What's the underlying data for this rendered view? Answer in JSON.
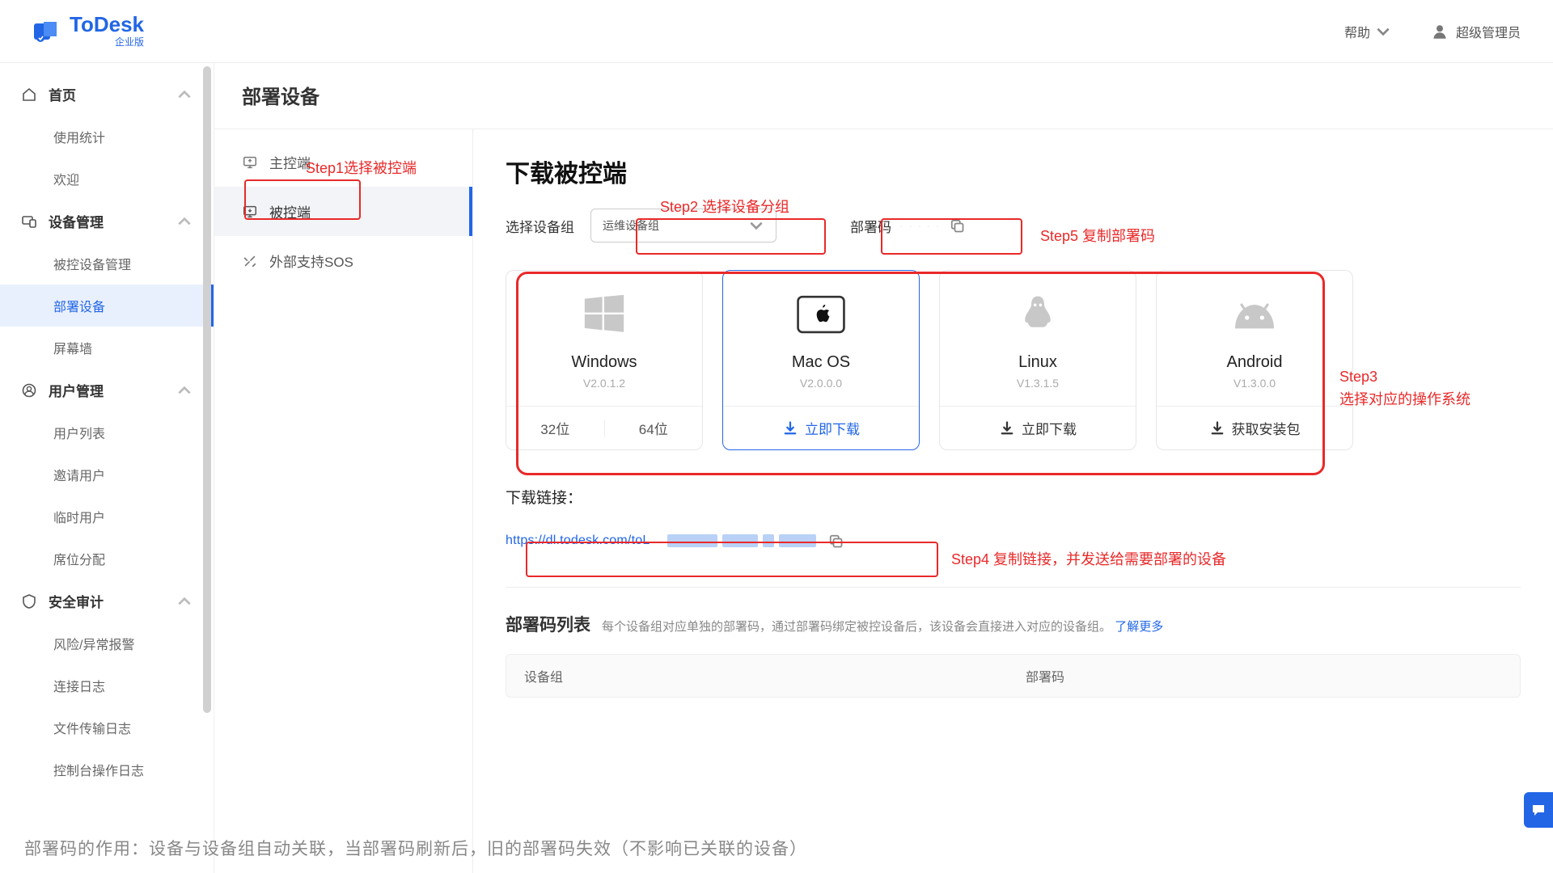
{
  "brand": {
    "name": "ToDesk",
    "edition": "企业版"
  },
  "header": {
    "help": "帮助",
    "user": "超级管理员"
  },
  "sidebar": {
    "groups": [
      {
        "label": "首页",
        "items": [
          "使用统计",
          "欢迎"
        ]
      },
      {
        "label": "设备管理",
        "items": [
          "被控设备管理",
          "部署设备",
          "屏幕墙"
        ],
        "activeIndex": 1
      },
      {
        "label": "用户管理",
        "items": [
          "用户列表",
          "邀请用户",
          "临时用户",
          "席位分配"
        ]
      },
      {
        "label": "安全审计",
        "items": [
          "风险/异常报警",
          "连接日志",
          "文件传输日志",
          "控制台操作日志"
        ]
      }
    ]
  },
  "page": {
    "title": "部署设备"
  },
  "tabs": {
    "items": [
      "主控端",
      "被控端",
      "外部支持SOS"
    ],
    "activeIndex": 1
  },
  "download": {
    "section_title": "下载被控端",
    "group_label": "选择设备组",
    "group_value": "运维设备组",
    "code_label": "部署码",
    "cards": [
      {
        "name": "Windows",
        "ver": "V2.0.1.2",
        "action_a": "32位",
        "action_b": "64位",
        "kind": "split"
      },
      {
        "name": "Mac OS",
        "ver": "V2.0.0.0",
        "action": "立即下载",
        "kind": "primary"
      },
      {
        "name": "Linux",
        "ver": "V1.3.1.5",
        "action": "立即下载",
        "kind": "plain"
      },
      {
        "name": "Android",
        "ver": "V1.3.0.0",
        "action": "获取安装包",
        "kind": "plain"
      }
    ],
    "link_label": "下载链接：",
    "link_url": "https://dl.todesk.com/toL"
  },
  "list": {
    "title": "部署码列表",
    "subtitle": "每个设备组对应单独的部署码，通过部署码绑定被控设备后，该设备会直接进入对应的设备组。",
    "learn_more": "了解更多",
    "cols": [
      "设备组",
      "部署码"
    ]
  },
  "annotations": {
    "step1": "Step1选择被控端",
    "step2": "Step2 选择设备分组",
    "step3a": "Step3",
    "step3b": "选择对应的操作系统",
    "step4": "Step4 复制链接，并发送给需要部署的设备",
    "step5": "Step5 复制部署码"
  },
  "footer_note": "部署码的作用：设备与设备组自动关联，当部署码刷新后，旧的部署码失效（不影响已关联的设备）"
}
